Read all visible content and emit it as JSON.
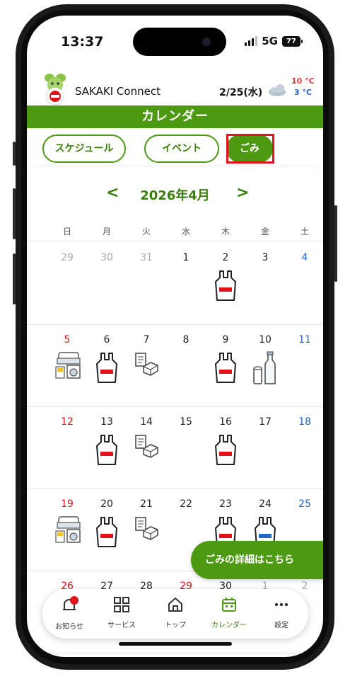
{
  "status_bar": {
    "time": "13:37",
    "network": "5G",
    "battery": "77"
  },
  "app_bar": {
    "title": "SAKAKI Connect",
    "date": "2/25(水)",
    "temp_high": "10 °C",
    "temp_low": "3 °C"
  },
  "page_title": "カレンダー",
  "tabs": [
    {
      "label": "スケジュール",
      "active": false
    },
    {
      "label": "イベント",
      "active": false
    },
    {
      "label": "ごみ",
      "active": true
    }
  ],
  "calendar": {
    "month_label": "2026年4月",
    "prev": "<",
    "next": ">",
    "weekdays": [
      "日",
      "月",
      "火",
      "水",
      "木",
      "金",
      "土"
    ],
    "weeks": [
      [
        "29",
        "30",
        "31",
        "1",
        "2",
        "3",
        "4"
      ],
      [
        "5",
        "6",
        "7",
        "8",
        "9",
        "10",
        "11"
      ],
      [
        "12",
        "13",
        "14",
        "15",
        "16",
        "17",
        "18"
      ],
      [
        "19",
        "20",
        "21",
        "22",
        "23",
        "24",
        "25"
      ],
      [
        "26",
        "27",
        "28",
        "29",
        "30",
        "1",
        "2"
      ]
    ],
    "icon_names": {
      "burnable": "red-bag-icon",
      "nonburnable": "blue-bag-icon",
      "plastic": "plastic-container-icon",
      "bottles": "can-bottle-icon",
      "bulky": "bulky-waste-icon"
    }
  },
  "fab_label": "ごみの詳細はこちら",
  "bottom_nav": [
    {
      "label": "お知らせ",
      "icon": "bell-icon"
    },
    {
      "label": "サービス",
      "icon": "grid-icon"
    },
    {
      "label": "トップ",
      "icon": "home-icon"
    },
    {
      "label": "カレンダー",
      "icon": "calendar-icon"
    },
    {
      "label": "設定",
      "icon": "more-icon"
    }
  ],
  "colors": {
    "brand_green": "#4d9a12",
    "sunday": "#e0131b",
    "saturday": "#2563c7",
    "highlight": "#e0131b"
  }
}
